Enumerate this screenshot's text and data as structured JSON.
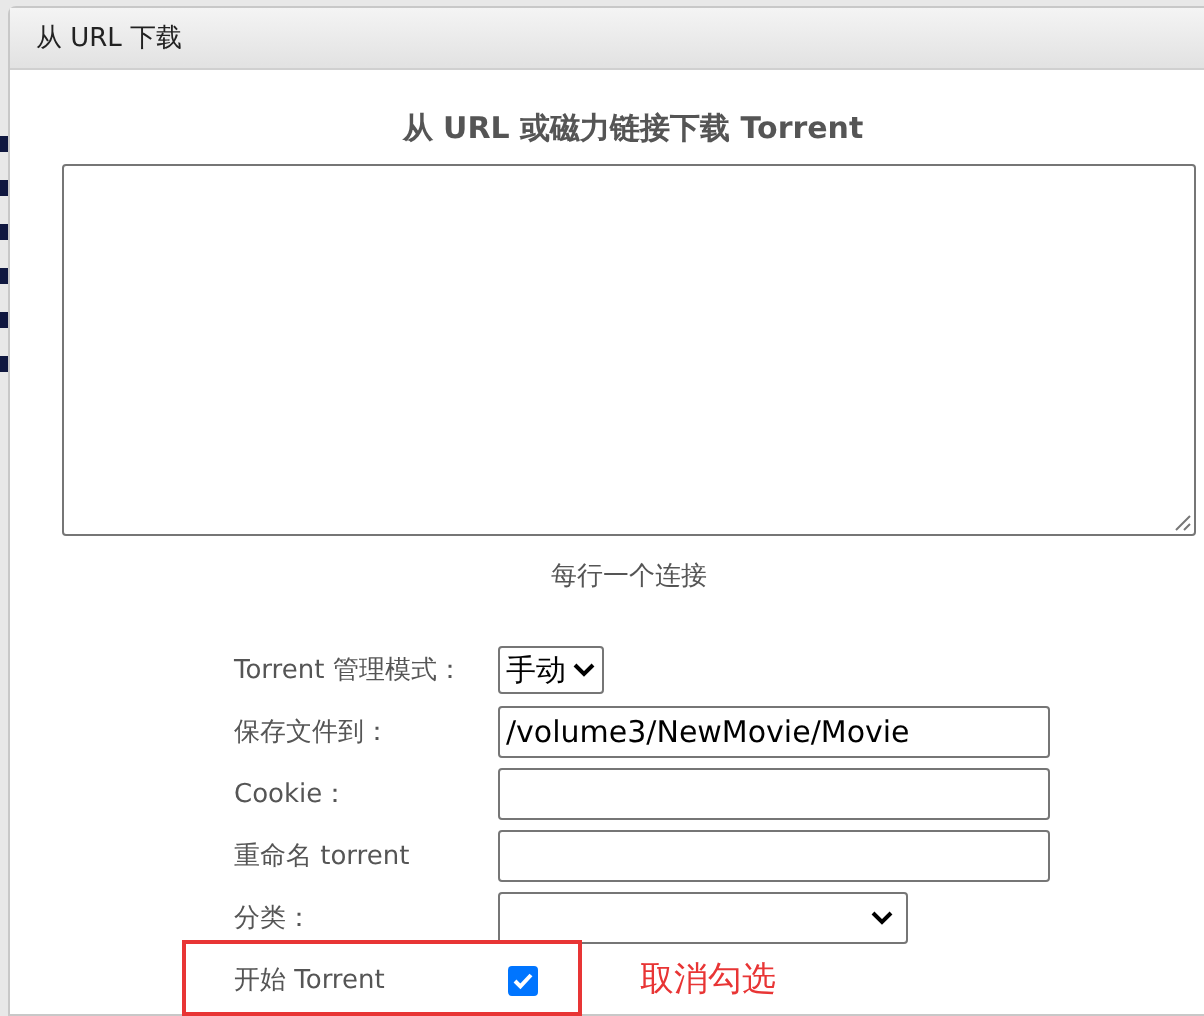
{
  "dialog": {
    "title": "从 URL 下载",
    "heading": "从 URL 或磁力链接下载 Torrent",
    "hint": "每行一个连接"
  },
  "fields": [
    {
      "kind": "select",
      "label": "Torrent 管理模式：",
      "value": "手动"
    },
    {
      "kind": "text",
      "label": "保存文件到：",
      "value": "/volume3/NewMovie/Movie"
    },
    {
      "kind": "text",
      "label": "Cookie："
    },
    {
      "kind": "text",
      "label": "重命名 torrent"
    },
    {
      "kind": "wideselect",
      "label": "分类："
    },
    {
      "kind": "checkbox",
      "label": "开始 Torrent",
      "checked": true
    }
  ],
  "annotation": {
    "text": "取消勾选"
  }
}
